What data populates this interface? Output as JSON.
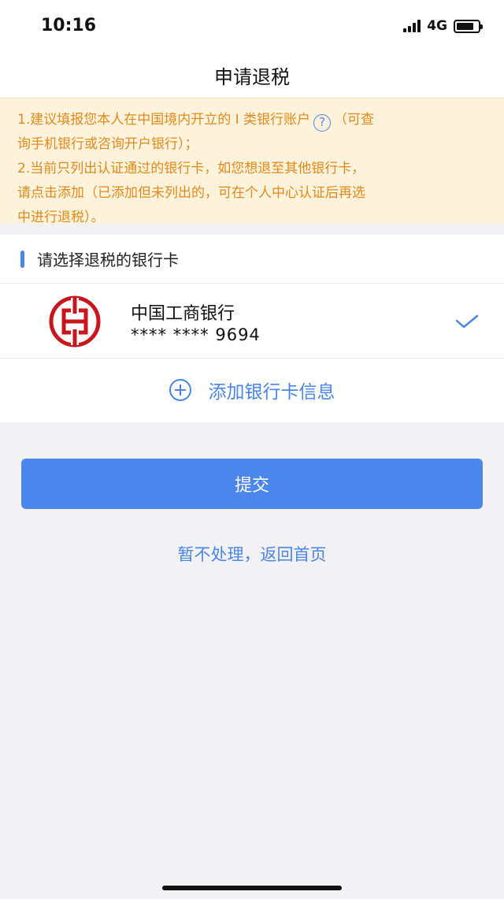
{
  "status_bar": {
    "time": "10:16",
    "network": "4G"
  },
  "header": {
    "title": "申请退税"
  },
  "notice": {
    "line1_before": "1.建议填报您本人在中国境内开立的 I 类银行账户",
    "help_symbol": "?",
    "line1_after": "（可查",
    "line2": "询手机银行或咨询开户银行）；",
    "line3": "2.当前只列出认证通过的银行卡，如您想退至其他银行卡，",
    "line4": "请点击添加（已添加但未列出的，可在个人中心认证后再选",
    "line5": "中进行退税）。"
  },
  "section": {
    "title": "请选择退税的银行卡"
  },
  "bank_card": {
    "name": "中国工商银行",
    "number": "**** **** 9694",
    "selected": true,
    "logo_icon": "icbc-logo-icon",
    "brand_color": "#c8161d"
  },
  "add_card": {
    "label": "添加银行卡信息"
  },
  "actions": {
    "submit_label": "提交",
    "back_label": "暂不处理，返回首页"
  },
  "colors": {
    "accent": "#4a86ec",
    "notice_text": "#e48a1a",
    "notice_bg": "#fdf3dc"
  }
}
